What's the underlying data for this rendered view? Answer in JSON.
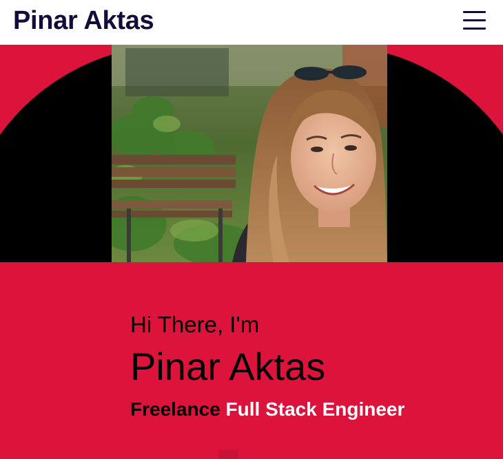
{
  "header": {
    "brand": "Pinar Aktas",
    "menu_icon": "hamburger-menu-icon"
  },
  "hero": {
    "photo_subject": "portrait-photo",
    "greeting": "Hi There, I'm",
    "name": "Pinar Aktas",
    "role_prefix": "Freelance",
    "role_highlight": "Full Stack Engineer"
  },
  "colors": {
    "navbar_background": "#ffffff",
    "brand_text": "#150a3c",
    "hero_background": "#dc143c",
    "hero_arch": "#000000",
    "text_primary": "#000000",
    "text_highlight": "#ffffff"
  }
}
